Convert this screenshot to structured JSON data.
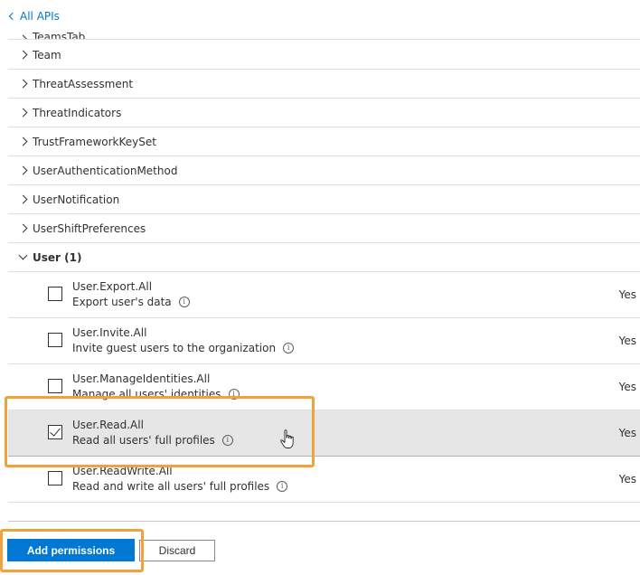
{
  "nav": {
    "back_label": "All APIs"
  },
  "groups_top": [
    {
      "label": "TeamsTab"
    },
    {
      "label": "Team"
    },
    {
      "label": "ThreatAssessment"
    },
    {
      "label": "ThreatIndicators"
    },
    {
      "label": "TrustFrameworkKeySet"
    },
    {
      "label": "UserAuthenticationMethod"
    },
    {
      "label": "UserNotification"
    },
    {
      "label": "UserShiftPreferences"
    }
  ],
  "expanded_group": {
    "label": "User (1)"
  },
  "permissions": [
    {
      "name": "User.Export.All",
      "description": "Export user's data",
      "admin_consent": "Yes",
      "checked": false
    },
    {
      "name": "User.Invite.All",
      "description": "Invite guest users to the organization",
      "admin_consent": "Yes",
      "checked": false
    },
    {
      "name": "User.ManageIdentities.All",
      "description": "Manage all users' identities",
      "admin_consent": "Yes",
      "checked": false
    },
    {
      "name": "User.Read.All",
      "description": "Read all users' full profiles",
      "admin_consent": "Yes",
      "checked": true
    },
    {
      "name": "User.ReadWrite.All",
      "description": "Read and write all users' full profiles",
      "admin_consent": "Yes",
      "checked": false
    }
  ],
  "actions": {
    "add_label": "Add permissions",
    "discard_label": "Discard"
  },
  "colors": {
    "accent": "#0078d4",
    "highlight": "#f0a23b",
    "selected_row": "#e6e6e6"
  },
  "icons": {
    "info": "info-icon",
    "back": "chevron-left-icon",
    "expand": "chevron-right-icon",
    "collapse": "chevron-down-icon",
    "cursor": "hand-cursor-icon"
  }
}
